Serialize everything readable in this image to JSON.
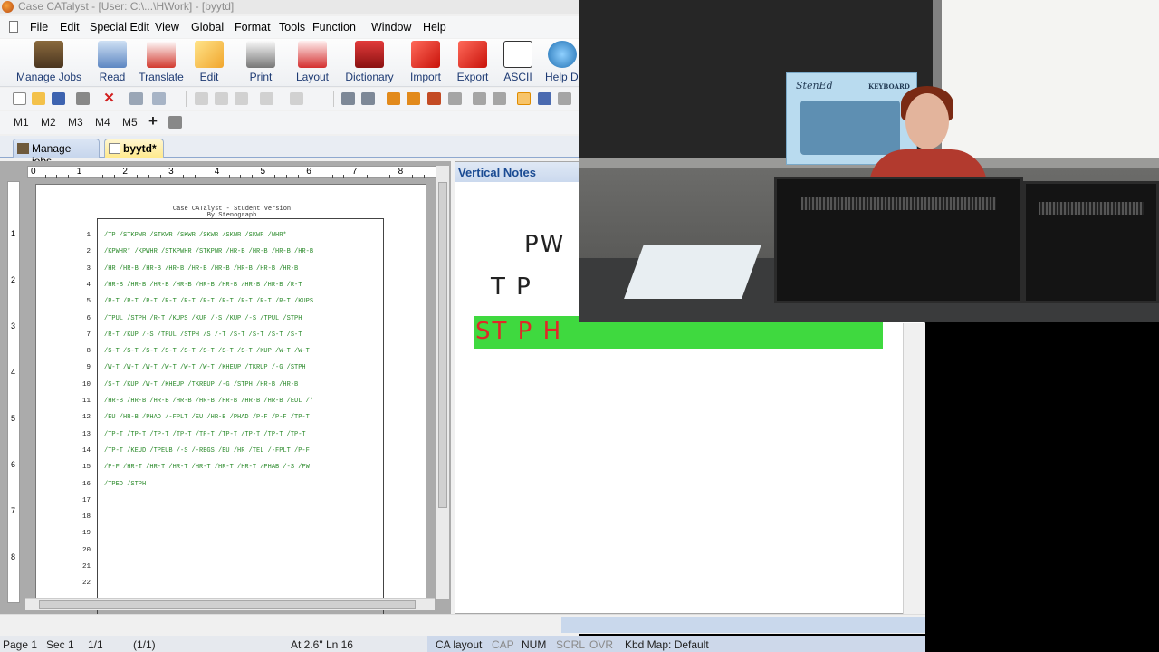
{
  "window": {
    "title": "Case CATalyst - [User: C:\\...\\HWork] - [byytd]"
  },
  "menu": [
    "File",
    "Edit",
    "Special Edit",
    "View",
    "Global",
    "Format",
    "Tools",
    "Function",
    "Window",
    "Help"
  ],
  "ribbon": {
    "buttons": [
      {
        "label": "Manage Jobs",
        "icon": "briefcase-icon"
      },
      {
        "label": "Read",
        "icon": "read-icon"
      },
      {
        "label": "Translate",
        "icon": "translate-icon"
      },
      {
        "label": "Edit",
        "icon": "pencil-icon"
      },
      {
        "label": "Print",
        "icon": "printer-icon"
      },
      {
        "label": "Layout",
        "icon": "layout-icon"
      },
      {
        "label": "Dictionary",
        "icon": "dictionary-icon"
      },
      {
        "label": "Import",
        "icon": "import-icon"
      },
      {
        "label": "Export",
        "icon": "export-icon"
      },
      {
        "label": "ASCII",
        "icon": "ascii-icon"
      },
      {
        "label": "Help De",
        "icon": "globe-icon"
      }
    ]
  },
  "macros": [
    "M1",
    "M2",
    "M3",
    "M4",
    "M5"
  ],
  "tabs": [
    {
      "label": "Manage jobs"
    },
    {
      "label": "byytd*"
    }
  ],
  "ruler": {
    "numbers": [
      "0",
      "1",
      "2",
      "3",
      "4",
      "5",
      "6",
      "7",
      "8"
    ]
  },
  "vruler": {
    "numbers": [
      "1",
      "2",
      "3",
      "4",
      "5",
      "6",
      "7",
      "8"
    ]
  },
  "document": {
    "header_line1": "Case CATalyst - Student Version",
    "header_line2": "By Stenograph",
    "lines": [
      {
        "n": "1",
        "text": "/TP /STKPWR /STKWR /SKWR /SKWR /SKWR /SKWR /WHR*"
      },
      {
        "n": "2",
        "text": "/KPWHR* /KPWHR /STKPWHR /STKPWR /HR-B /HR-B /HR-B /HR-B"
      },
      {
        "n": "3",
        "text": "/HR /HR-B /HR-B /HR-B /HR-B /HR-B /HR-B /HR-B /HR-B"
      },
      {
        "n": "4",
        "text": "/HR-B /HR-B /HR-B /HR-B /HR-B /HR-B /HR-B /HR-B /R-T"
      },
      {
        "n": "5",
        "text": "/R-T /R-T /R-T /R-T /R-T /R-T /R-T /R-T /R-T /R-T /KUPS"
      },
      {
        "n": "6",
        "text": "/TPUL /STPH /R-T /KUPS /KUP /-S /KUP /-S /TPUL /STPH"
      },
      {
        "n": "7",
        "text": "/R-T /KUP /-S /TPUL /STPH /S /-T /S-T /S-T /S-T /S-T"
      },
      {
        "n": "8",
        "text": "/S-T /S-T /S-T /S-T /S-T /S-T /S-T /S-T /KUP /W-T /W-T"
      },
      {
        "n": "9",
        "text": "/W-T /W-T /W-T /W-T /W-T /W-T /KHEUP /TKRUP /-G /STPH"
      },
      {
        "n": "10",
        "text": "/S-T /KUP /W-T /KHEUP /TKREUP /-G /STPH /HR-B /HR-B"
      },
      {
        "n": "11",
        "text": "/HR-B /HR-B /HR-B /HR-B /HR-B /HR-B /HR-B /HR-B /EUL /*"
      },
      {
        "n": "12",
        "text": "/EU /HR-B /PHAD /-FPLT /EU /HR-B /PHAD /P-F /P-F /TP-T"
      },
      {
        "n": "13",
        "text": "/TP-T /TP-T /TP-T /TP-T /TP-T /TP-T /TP-T /TP-T /TP-T"
      },
      {
        "n": "14",
        "text": "/TP-T /KEUD /TPEUB /-S /-RBGS /EU /HR /TEL /-FPLT /P-F"
      },
      {
        "n": "15",
        "text": "/P-F /HR-T /HR-T /HR-T /HR-T /HR-T /HR-T /PHAB /-S /PW"
      },
      {
        "n": "16",
        "text": "/TPED /STPH"
      },
      {
        "n": "17",
        "text": ""
      },
      {
        "n": "18",
        "text": ""
      },
      {
        "n": "19",
        "text": ""
      },
      {
        "n": "20",
        "text": ""
      },
      {
        "n": "21",
        "text": ""
      },
      {
        "n": "22",
        "text": ""
      }
    ]
  },
  "vertical_notes": {
    "title": "Vertical Notes",
    "strokes": [
      "PW",
      "T P",
      "ST P H"
    ],
    "highlight_color": "#3fd93f",
    "current_stroke_color": "#e12727"
  },
  "statusbar": {
    "page": "Page 1",
    "sec": "Sec 1",
    "pos": "1/1",
    "pos2": "(1/1)",
    "at": "At 2.6\" Ln 16",
    "layout": "CA layout",
    "cap": "CAP",
    "num": "NUM",
    "scrl": "SCRL",
    "ovr": "OVR",
    "kbd": "Kbd Map: Default"
  },
  "webcam": {
    "poster_brand": "StenEd",
    "poster_subtitle": "KEYBOARD"
  }
}
